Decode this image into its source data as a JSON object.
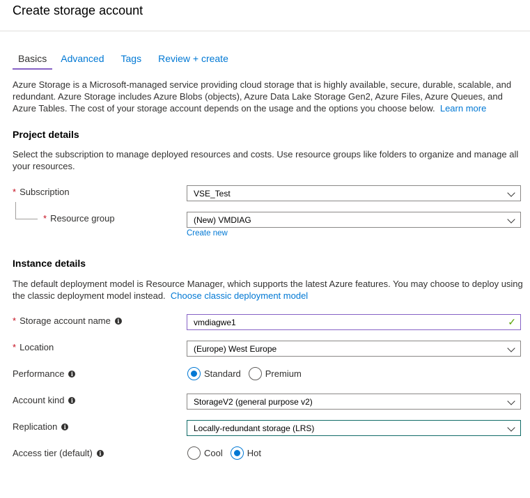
{
  "title": "Create storage account",
  "tabs": [
    {
      "label": "Basics",
      "active": true
    },
    {
      "label": "Advanced",
      "active": false
    },
    {
      "label": "Tags",
      "active": false
    },
    {
      "label": "Review + create",
      "active": false
    }
  ],
  "intro": {
    "text": "Azure Storage is a Microsoft-managed service providing cloud storage that is highly available, secure, durable, scalable, and redundant. Azure Storage includes Azure Blobs (objects), Azure Data Lake Storage Gen2, Azure Files, Azure Queues, and Azure Tables. The cost of your storage account depends on the usage and the options you choose below.",
    "link": "Learn more"
  },
  "project": {
    "heading": "Project details",
    "description": "Select the subscription to manage deployed resources and costs. Use resource groups like folders to organize and manage all your resources.",
    "subscription": {
      "label": "Subscription",
      "value": "VSE_Test"
    },
    "resource_group": {
      "label": "Resource group",
      "value": "(New) VMDIAG",
      "create_new": "Create new"
    }
  },
  "instance": {
    "heading": "Instance details",
    "description": "The default deployment model is Resource Manager, which supports the latest Azure features. You may choose to deploy using the classic deployment model instead.",
    "link": "Choose classic deployment model",
    "storage_name": {
      "label": "Storage account name",
      "value": "vmdiagwe1"
    },
    "location": {
      "label": "Location",
      "value": "(Europe) West Europe"
    },
    "performance": {
      "label": "Performance",
      "options": [
        "Standard",
        "Premium"
      ],
      "selected": "Standard"
    },
    "account_kind": {
      "label": "Account kind",
      "value": "StorageV2 (general purpose v2)"
    },
    "replication": {
      "label": "Replication",
      "value": "Locally-redundant storage (LRS)"
    },
    "access_tier": {
      "label": "Access tier (default)",
      "options": [
        "Cool",
        "Hot"
      ],
      "selected": "Hot"
    }
  },
  "required_mark": "*",
  "info_glyph": "i",
  "check_glyph": "✓",
  "colors": {
    "link": "#0078d4",
    "required": "#c50f1f",
    "valid": "#57a300",
    "tab_underline": "#8661c5"
  }
}
